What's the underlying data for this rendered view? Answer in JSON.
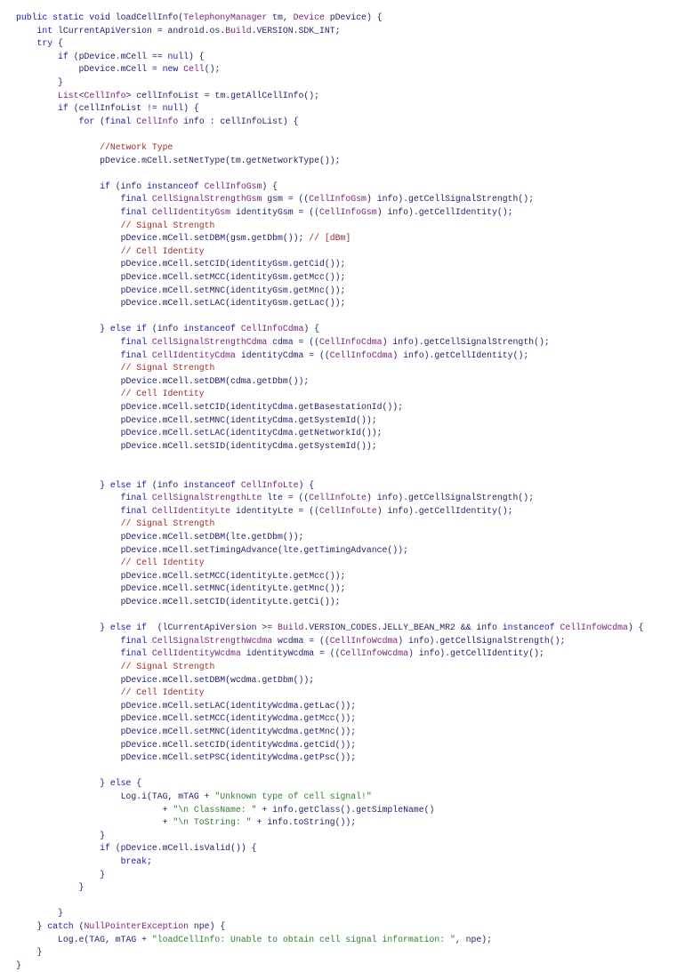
{
  "editor": {
    "language": "java",
    "colors": {
      "background": "#ffffff",
      "plain": "#1f1f6b",
      "keyword": "#1a1aa6",
      "type": "#7a1f7a",
      "comment": "#a52a2a",
      "string": "#2e7d32"
    },
    "lines": [
      [
        [
          "k",
          "public static void "
        ],
        [
          "p",
          "loadCellInfo("
        ],
        [
          "t",
          "TelephonyManager"
        ],
        [
          "p",
          " tm, "
        ],
        [
          "t",
          "Device"
        ],
        [
          "p",
          " pDevice) {"
        ]
      ],
      [
        [
          "p",
          "    "
        ],
        [
          "k",
          "int"
        ],
        [
          "p",
          " lCurrentApiVersion = android.os."
        ],
        [
          "t",
          "Build"
        ],
        [
          "p",
          ".VERSION.SDK_INT;"
        ]
      ],
      [
        [
          "p",
          "    "
        ],
        [
          "k",
          "try"
        ],
        [
          "p",
          " {"
        ]
      ],
      [
        [
          "p",
          "        "
        ],
        [
          "k",
          "if"
        ],
        [
          "p",
          " (pDevice.mCell == "
        ],
        [
          "k",
          "null"
        ],
        [
          "p",
          ") {"
        ]
      ],
      [
        [
          "p",
          "            pDevice.mCell = "
        ],
        [
          "k",
          "new "
        ],
        [
          "t",
          "Cell"
        ],
        [
          "p",
          "();"
        ]
      ],
      [
        [
          "p",
          "        }"
        ]
      ],
      [
        [
          "p",
          "        "
        ],
        [
          "t",
          "List"
        ],
        [
          "p",
          "<"
        ],
        [
          "t",
          "CellInfo"
        ],
        [
          "p",
          "> cellInfoList = tm.getAllCellInfo();"
        ]
      ],
      [
        [
          "p",
          "        "
        ],
        [
          "k",
          "if"
        ],
        [
          "p",
          " (cellInfoList != "
        ],
        [
          "k",
          "null"
        ],
        [
          "p",
          ") {"
        ]
      ],
      [
        [
          "p",
          "            "
        ],
        [
          "k",
          "for"
        ],
        [
          "p",
          " ("
        ],
        [
          "k",
          "final "
        ],
        [
          "t",
          "CellInfo"
        ],
        [
          "p",
          " info : cellInfoList) {"
        ]
      ],
      [],
      [
        [
          "p",
          "                "
        ],
        [
          "c",
          "//Network Type"
        ]
      ],
      [
        [
          "p",
          "                pDevice.mCell.setNetType(tm.getNetworkType());"
        ]
      ],
      [],
      [
        [
          "p",
          "                "
        ],
        [
          "k",
          "if"
        ],
        [
          "p",
          " (info "
        ],
        [
          "k",
          "instanceof "
        ],
        [
          "t",
          "CellInfoGsm"
        ],
        [
          "p",
          ") {"
        ]
      ],
      [
        [
          "p",
          "                    "
        ],
        [
          "k",
          "final "
        ],
        [
          "t",
          "CellSignalStrengthGsm"
        ],
        [
          "p",
          " gsm = (("
        ],
        [
          "t",
          "CellInfoGsm"
        ],
        [
          "p",
          ") info).getCellSignalStrength();"
        ]
      ],
      [
        [
          "p",
          "                    "
        ],
        [
          "k",
          "final "
        ],
        [
          "t",
          "CellIdentityGsm"
        ],
        [
          "p",
          " identityGsm = (("
        ],
        [
          "t",
          "CellInfoGsm"
        ],
        [
          "p",
          ") info).getCellIdentity();"
        ]
      ],
      [
        [
          "p",
          "                    "
        ],
        [
          "c",
          "// Signal Strength"
        ]
      ],
      [
        [
          "p",
          "                    pDevice.mCell.setDBM(gsm.getDbm()); "
        ],
        [
          "c",
          "// [dBm]"
        ]
      ],
      [
        [
          "p",
          "                    "
        ],
        [
          "c",
          "// Cell Identity"
        ]
      ],
      [
        [
          "p",
          "                    pDevice.mCell.setCID(identityGsm.getCid());"
        ]
      ],
      [
        [
          "p",
          "                    pDevice.mCell.setMCC(identityGsm.getMcc());"
        ]
      ],
      [
        [
          "p",
          "                    pDevice.mCell.setMNC(identityGsm.getMnc());"
        ]
      ],
      [
        [
          "p",
          "                    pDevice.mCell.setLAC(identityGsm.getLac());"
        ]
      ],
      [],
      [
        [
          "p",
          "                } "
        ],
        [
          "k",
          "else if"
        ],
        [
          "p",
          " (info "
        ],
        [
          "k",
          "instanceof "
        ],
        [
          "t",
          "CellInfoCdma"
        ],
        [
          "p",
          ") {"
        ]
      ],
      [
        [
          "p",
          "                    "
        ],
        [
          "k",
          "final "
        ],
        [
          "t",
          "CellSignalStrengthCdma"
        ],
        [
          "p",
          " cdma = (("
        ],
        [
          "t",
          "CellInfoCdma"
        ],
        [
          "p",
          ") info).getCellSignalStrength();"
        ]
      ],
      [
        [
          "p",
          "                    "
        ],
        [
          "k",
          "final "
        ],
        [
          "t",
          "CellIdentityCdma"
        ],
        [
          "p",
          " identityCdma = (("
        ],
        [
          "t",
          "CellInfoCdma"
        ],
        [
          "p",
          ") info).getCellIdentity();"
        ]
      ],
      [
        [
          "p",
          "                    "
        ],
        [
          "c",
          "// Signal Strength"
        ]
      ],
      [
        [
          "p",
          "                    pDevice.mCell.setDBM(cdma.getDbm());"
        ]
      ],
      [
        [
          "p",
          "                    "
        ],
        [
          "c",
          "// Cell Identity"
        ]
      ],
      [
        [
          "p",
          "                    pDevice.mCell.setCID(identityCdma.getBasestationId());"
        ]
      ],
      [
        [
          "p",
          "                    pDevice.mCell.setMNC(identityCdma.getSystemId());"
        ]
      ],
      [
        [
          "p",
          "                    pDevice.mCell.setLAC(identityCdma.getNetworkId());"
        ]
      ],
      [
        [
          "p",
          "                    pDevice.mCell.setSID(identityCdma.getSystemId());"
        ]
      ],
      [],
      [],
      [
        [
          "p",
          "                } "
        ],
        [
          "k",
          "else if"
        ],
        [
          "p",
          " (info "
        ],
        [
          "k",
          "instanceof "
        ],
        [
          "t",
          "CellInfoLte"
        ],
        [
          "p",
          ") {"
        ]
      ],
      [
        [
          "p",
          "                    "
        ],
        [
          "k",
          "final "
        ],
        [
          "t",
          "CellSignalStrengthLte"
        ],
        [
          "p",
          " lte = (("
        ],
        [
          "t",
          "CellInfoLte"
        ],
        [
          "p",
          ") info).getCellSignalStrength();"
        ]
      ],
      [
        [
          "p",
          "                    "
        ],
        [
          "k",
          "final "
        ],
        [
          "t",
          "CellIdentityLte"
        ],
        [
          "p",
          " identityLte = (("
        ],
        [
          "t",
          "CellInfoLte"
        ],
        [
          "p",
          ") info).getCellIdentity();"
        ]
      ],
      [
        [
          "p",
          "                    "
        ],
        [
          "c",
          "// Signal Strength"
        ]
      ],
      [
        [
          "p",
          "                    pDevice.mCell.setDBM(lte.getDbm());"
        ]
      ],
      [
        [
          "p",
          "                    pDevice.mCell.setTimingAdvance(lte.getTimingAdvance());"
        ]
      ],
      [
        [
          "p",
          "                    "
        ],
        [
          "c",
          "// Cell Identity"
        ]
      ],
      [
        [
          "p",
          "                    pDevice.mCell.setMCC(identityLte.getMcc());"
        ]
      ],
      [
        [
          "p",
          "                    pDevice.mCell.setMNC(identityLte.getMnc());"
        ]
      ],
      [
        [
          "p",
          "                    pDevice.mCell.setCID(identityLte.getCi());"
        ]
      ],
      [],
      [
        [
          "p",
          "                } "
        ],
        [
          "k",
          "else if"
        ],
        [
          "p",
          "  (lCurrentApiVersion >= "
        ],
        [
          "t",
          "Build"
        ],
        [
          "p",
          ".VERSION_CODES.JELLY_BEAN_MR2 && info "
        ],
        [
          "k",
          "instanceof "
        ],
        [
          "t",
          "CellInfoWcdma"
        ],
        [
          "p",
          ") {"
        ]
      ],
      [
        [
          "p",
          "                    "
        ],
        [
          "k",
          "final "
        ],
        [
          "t",
          "CellSignalStrengthWcdma"
        ],
        [
          "p",
          " wcdma = (("
        ],
        [
          "t",
          "CellInfoWcdma"
        ],
        [
          "p",
          ") info).getCellSignalStrength();"
        ]
      ],
      [
        [
          "p",
          "                    "
        ],
        [
          "k",
          "final "
        ],
        [
          "t",
          "CellIdentityWcdma"
        ],
        [
          "p",
          " identityWcdma = (("
        ],
        [
          "t",
          "CellInfoWcdma"
        ],
        [
          "p",
          ") info).getCellIdentity();"
        ]
      ],
      [
        [
          "p",
          "                    "
        ],
        [
          "c",
          "// Signal Strength"
        ]
      ],
      [
        [
          "p",
          "                    pDevice.mCell.setDBM(wcdma.getDbm());"
        ]
      ],
      [
        [
          "p",
          "                    "
        ],
        [
          "c",
          "// Cell Identity"
        ]
      ],
      [
        [
          "p",
          "                    pDevice.mCell.setLAC(identityWcdma.getLac());"
        ]
      ],
      [
        [
          "p",
          "                    pDevice.mCell.setMCC(identityWcdma.getMcc());"
        ]
      ],
      [
        [
          "p",
          "                    pDevice.mCell.setMNC(identityWcdma.getMnc());"
        ]
      ],
      [
        [
          "p",
          "                    pDevice.mCell.setCID(identityWcdma.getCid());"
        ]
      ],
      [
        [
          "p",
          "                    pDevice.mCell.setPSC(identityWcdma.getPsc());"
        ]
      ],
      [],
      [
        [
          "p",
          "                } "
        ],
        [
          "k",
          "else"
        ],
        [
          "p",
          " {"
        ]
      ],
      [
        [
          "p",
          "                    Log.i(TAG, mTAG + "
        ],
        [
          "s",
          "\"Unknown type of cell signal!\""
        ]
      ],
      [
        [
          "p",
          "                            + "
        ],
        [
          "s",
          "\"\\n ClassName: \""
        ],
        [
          "p",
          " + info.getClass().getSimpleName()"
        ]
      ],
      [
        [
          "p",
          "                            + "
        ],
        [
          "s",
          "\"\\n ToString: \""
        ],
        [
          "p",
          " + info.toString());"
        ]
      ],
      [
        [
          "p",
          "                }"
        ]
      ],
      [
        [
          "p",
          "                "
        ],
        [
          "k",
          "if"
        ],
        [
          "p",
          " (pDevice.mCell.isValid()) {"
        ]
      ],
      [
        [
          "p",
          "                    "
        ],
        [
          "k",
          "break"
        ],
        [
          "p",
          ";"
        ]
      ],
      [
        [
          "p",
          "                }"
        ]
      ],
      [
        [
          "p",
          "            }"
        ]
      ],
      [],
      [
        [
          "p",
          "        }"
        ]
      ],
      [
        [
          "p",
          "    } "
        ],
        [
          "k",
          "catch"
        ],
        [
          "p",
          " ("
        ],
        [
          "t",
          "NullPointerException"
        ],
        [
          "p",
          " npe) {"
        ]
      ],
      [
        [
          "p",
          "        Log.e(TAG, mTAG + "
        ],
        [
          "s",
          "\"loadCellInfo: Unable to obtain cell signal information: \""
        ],
        [
          "p",
          ", npe);"
        ]
      ],
      [
        [
          "p",
          "    }"
        ]
      ],
      [
        [
          "p",
          "}"
        ]
      ]
    ]
  }
}
